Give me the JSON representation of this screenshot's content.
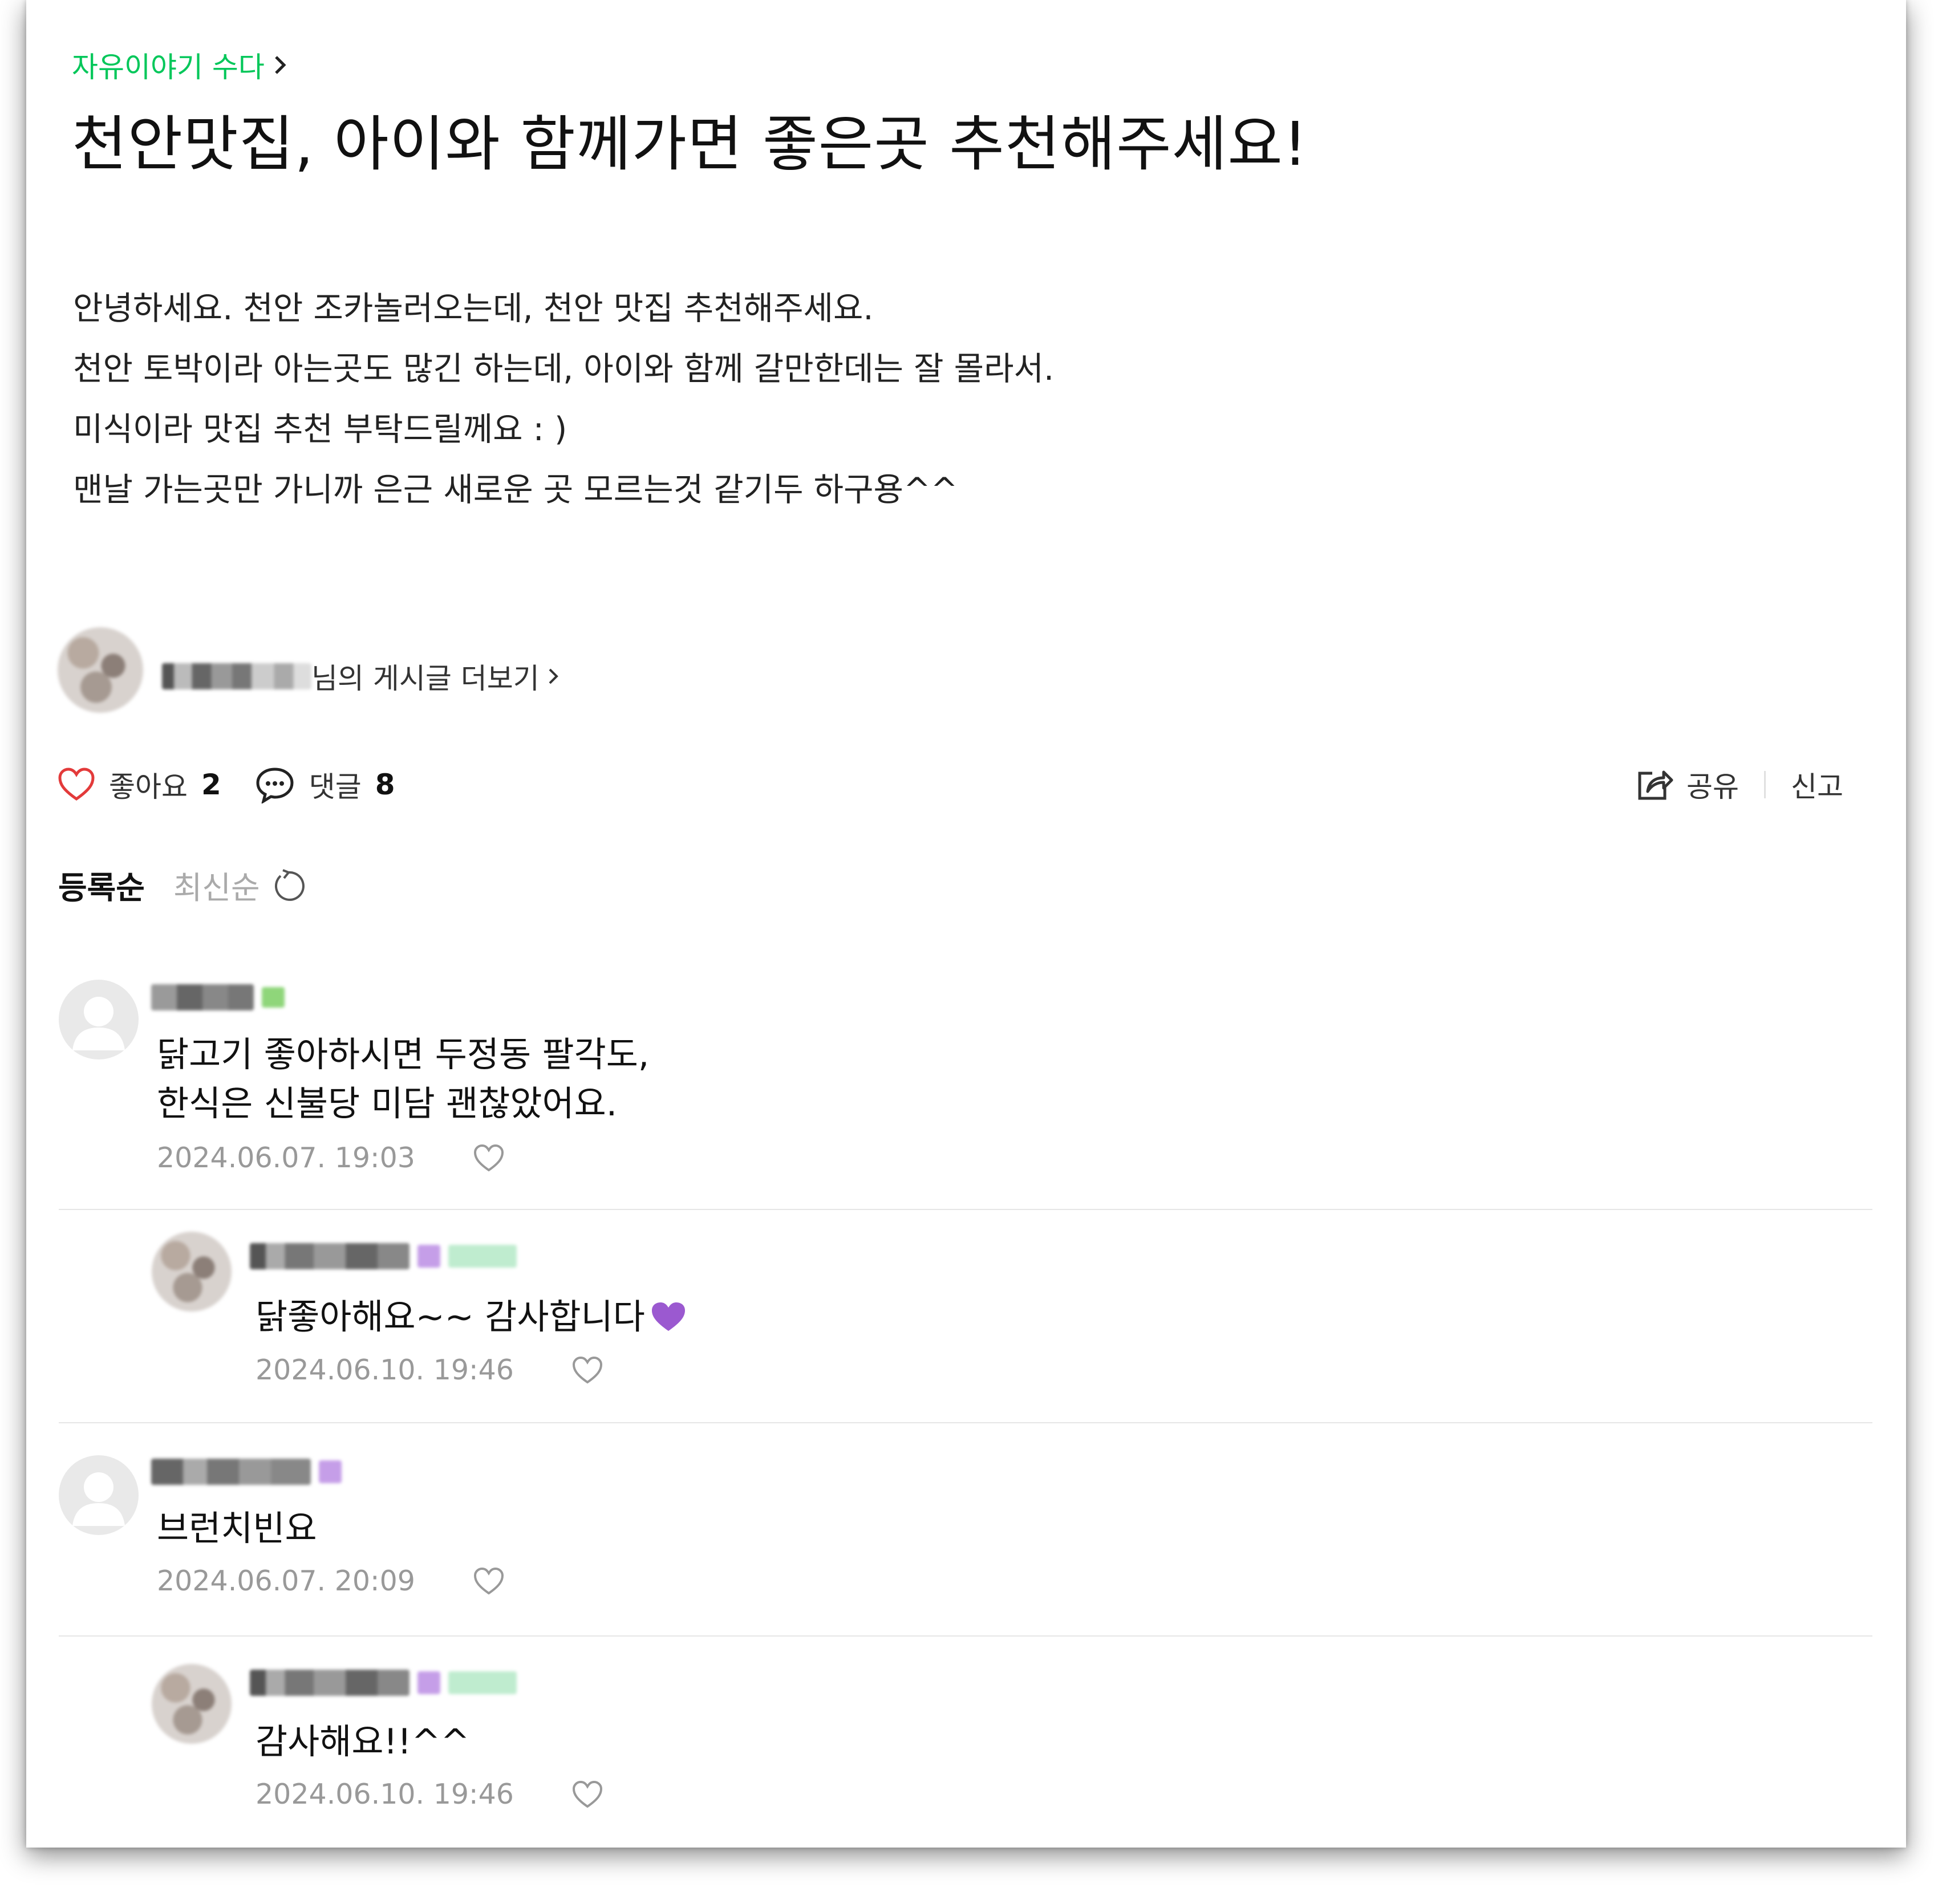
{
  "breadcrumb": {
    "label": "자유이야기 수다"
  },
  "post": {
    "title": "천안맛집, 아이와 함께가면 좋은곳 추천해주세요!",
    "body": [
      "안녕하세요. 천안 조카놀러오는데, 천안 맛집 추천해주세요.",
      "천안 토박이라 아는곳도 많긴 하는데, 아이와 함께 갈만한데는 잘 몰라서.",
      "미식이라 맛집 추천 부탁드릴께요 : )",
      "맨날 가는곳만 가니까 은근 새로운 곳 모르는것 같기두 하구용^^"
    ]
  },
  "author": {
    "more_suffix": "님의 게시글 더보기"
  },
  "actions": {
    "like_label": "좋아요",
    "like_count": "2",
    "comment_label": "댓글",
    "comment_count": "8",
    "share_label": "공유",
    "report_label": "신고"
  },
  "sort": {
    "active": "등록순",
    "inactive": "최신순"
  },
  "comments": [
    {
      "text": [
        "닭고기 좋아하시면 두정동 팔각도,",
        "한식은 신불당 미담 괜찮았어요."
      ],
      "date": "2024.06.07. 19:03"
    },
    {
      "text": [
        "닭좋아해요~~ 감사합니다"
      ],
      "date": "2024.06.10. 19:46"
    },
    {
      "text": [
        "브런치빈요"
      ],
      "date": "2024.06.07. 20:09"
    },
    {
      "text": [
        "감사해요!!^^"
      ],
      "date": "2024.06.10. 19:46"
    }
  ],
  "colors": {
    "accent": "#03c75a",
    "like_red": "#e33a3a",
    "meta_gray": "#999999"
  }
}
